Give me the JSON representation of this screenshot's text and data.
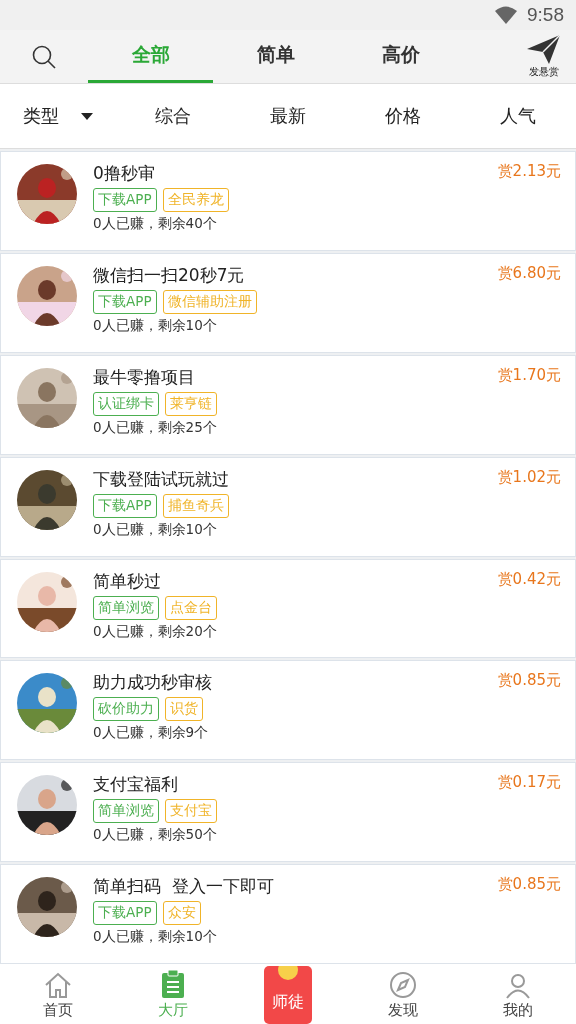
{
  "status_bar": {
    "time": "9:58"
  },
  "header": {
    "tabs": [
      {
        "label": "全部",
        "selected": true
      },
      {
        "label": "简单",
        "selected": false
      },
      {
        "label": "高价",
        "selected": false
      }
    ],
    "post_label": "发悬赏"
  },
  "filters": [
    {
      "label": "类型",
      "dropdown": true
    },
    {
      "label": "综合",
      "dropdown": false
    },
    {
      "label": "最新",
      "dropdown": false
    },
    {
      "label": "价格",
      "dropdown": false
    },
    {
      "label": "人气",
      "dropdown": false
    }
  ],
  "tasks": [
    {
      "title": "0撸秒审",
      "reward": "赏2.13元",
      "tags": [
        {
          "label": "下载APP",
          "color": "#4caf50"
        },
        {
          "label": "全民养龙",
          "color": "#f0b429"
        }
      ],
      "progress": "0人已赚，剩余40个"
    },
    {
      "title": "微信扫一扫20秒7元",
      "reward": "赏6.80元",
      "tags": [
        {
          "label": "下载APP",
          "color": "#4caf50"
        },
        {
          "label": "微信辅助注册",
          "color": "#f0b429"
        }
      ],
      "progress": "0人已赚，剩余10个"
    },
    {
      "title": "最牛零撸项目",
      "reward": "赏1.70元",
      "tags": [
        {
          "label": "认证绑卡",
          "color": "#4caf50"
        },
        {
          "label": "莱亨链",
          "color": "#f0b429"
        }
      ],
      "progress": "0人已赚，剩余25个"
    },
    {
      "title": "下载登陆试玩就过",
      "reward": "赏1.02元",
      "tags": [
        {
          "label": "下载APP",
          "color": "#4caf50"
        },
        {
          "label": "捕鱼奇兵",
          "color": "#f0b429"
        }
      ],
      "progress": "0人已赚，剩余10个"
    },
    {
      "title": "简单秒过",
      "reward": "赏0.42元",
      "tags": [
        {
          "label": "简单浏览",
          "color": "#4caf50"
        },
        {
          "label": "点金台",
          "color": "#f0b429"
        }
      ],
      "progress": "0人已赚，剩余20个"
    },
    {
      "title": "助力成功秒审核",
      "reward": "赏0.85元",
      "tags": [
        {
          "label": "砍价助力",
          "color": "#4caf50"
        },
        {
          "label": "识货",
          "color": "#f0b429"
        }
      ],
      "progress": "0人已赚，剩余9个"
    },
    {
      "title": "支付宝福利",
      "reward": "赏0.17元",
      "tags": [
        {
          "label": "简单浏览",
          "color": "#4caf50"
        },
        {
          "label": "支付宝",
          "color": "#f0b429"
        }
      ],
      "progress": "0人已赚，剩余50个"
    },
    {
      "title": "简单扫码  登入一下即可",
      "reward": "赏0.85元",
      "tags": [
        {
          "label": "下载APP",
          "color": "#4caf50"
        },
        {
          "label": "众安",
          "color": "#f0b429"
        }
      ],
      "progress": "0人已赚，剩余10个"
    }
  ],
  "bottom_nav": [
    {
      "kind": "tab",
      "label": "首页",
      "selected": false
    },
    {
      "kind": "tab",
      "label": "大厅",
      "selected": true
    },
    {
      "kind": "packet",
      "label": "师徒",
      "selected": false
    },
    {
      "kind": "tab",
      "label": "发现",
      "selected": false
    },
    {
      "kind": "tab",
      "label": "我的",
      "selected": false
    }
  ]
}
